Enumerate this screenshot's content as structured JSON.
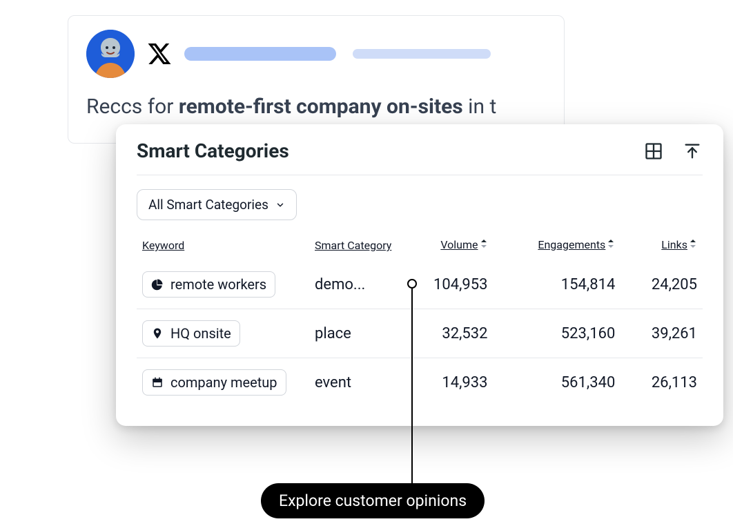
{
  "post": {
    "text_prefix": "Reccs for ",
    "text_bold": "remote-first company on-sites",
    "text_suffix": " in t"
  },
  "panel": {
    "title": "Smart Categories",
    "dropdown_label": "All Smart Categories",
    "columns": {
      "keyword": "Keyword",
      "category": "Smart Category",
      "volume": "Volume",
      "engagements": "Engagements",
      "links": "Links"
    },
    "rows": [
      {
        "keyword": "remote workers",
        "icon": "pie",
        "category": "demo...",
        "volume": "104,953",
        "engagements": "154,814",
        "links": "24,205"
      },
      {
        "keyword": "HQ onsite",
        "icon": "pin",
        "category": "place",
        "volume": "32,532",
        "engagements": "523,160",
        "links": "39,261"
      },
      {
        "keyword": "company meetup",
        "icon": "calendar",
        "category": "event",
        "volume": "14,933",
        "engagements": "561,340",
        "links": "26,113"
      }
    ]
  },
  "tooltip": "Explore customer opinions"
}
